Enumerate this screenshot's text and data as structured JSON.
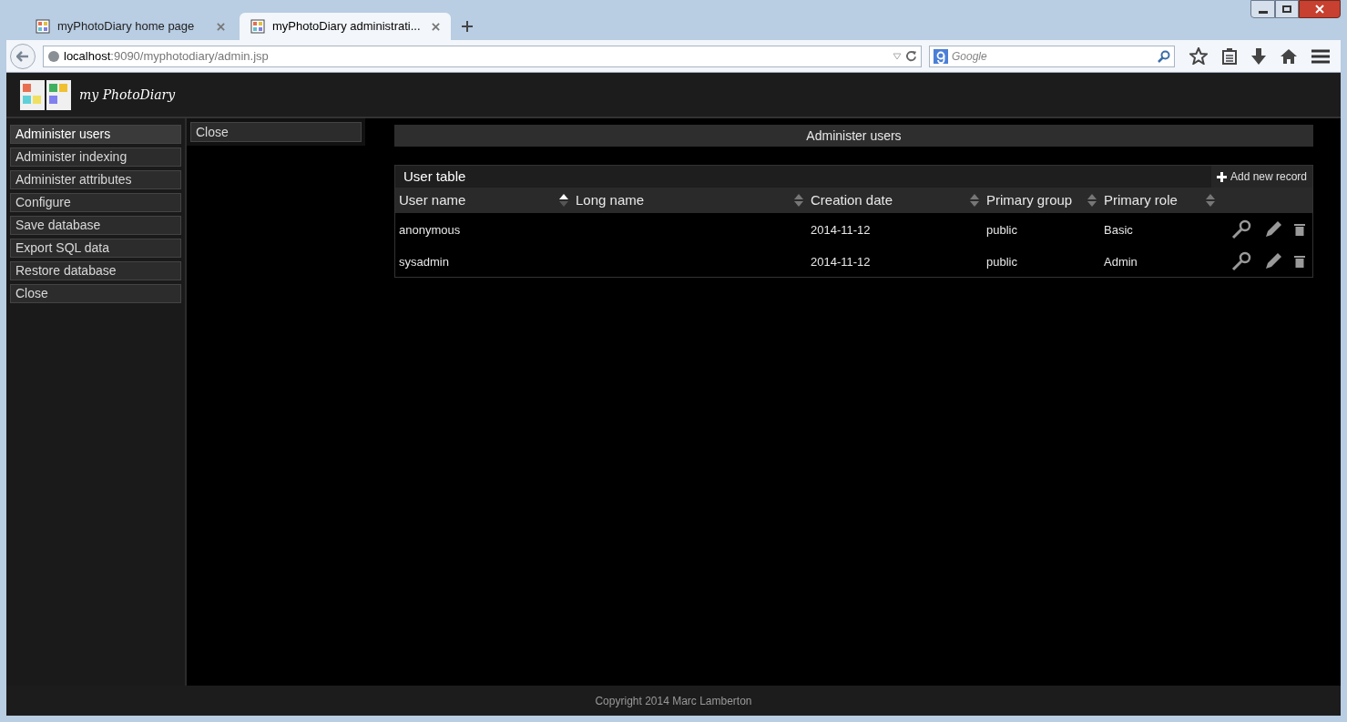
{
  "browser": {
    "tabs": [
      {
        "label": "myPhotoDiary home page",
        "selected": false
      },
      {
        "label": "myPhotoDiary administrati...",
        "selected": true
      }
    ],
    "url_host": "localhost",
    "url_path": ":9090/myphotodiary/admin.jsp",
    "search": {
      "placeholder": "Google"
    }
  },
  "header": {
    "logo_text": "my PhotoDiary"
  },
  "sidebar": {
    "items": [
      {
        "label": "Administer users",
        "selected": true
      },
      {
        "label": "Administer indexing",
        "selected": false
      },
      {
        "label": "Administer attributes",
        "selected": false
      },
      {
        "label": "Configure",
        "selected": false
      },
      {
        "label": "Save database",
        "selected": false
      },
      {
        "label": "Export SQL data",
        "selected": false
      },
      {
        "label": "Restore database",
        "selected": false
      },
      {
        "label": "Close",
        "selected": false
      }
    ]
  },
  "subpanel": {
    "items": [
      {
        "label": "Close"
      }
    ]
  },
  "main": {
    "title": "Administer users",
    "table": {
      "title": "User table",
      "add_button": "Add new record",
      "columns": [
        {
          "label": "User name",
          "sorted": true
        },
        {
          "label": "Long name",
          "sorted": false
        },
        {
          "label": "Creation date",
          "sorted": false
        },
        {
          "label": "Primary group",
          "sorted": false
        },
        {
          "label": "Primary role",
          "sorted": false
        }
      ],
      "rows": [
        [
          "anonymous",
          "",
          "2014-11-12",
          "public",
          "Basic"
        ],
        [
          "sysadmin",
          "",
          "2014-11-12",
          "public",
          "Admin"
        ]
      ]
    }
  },
  "footer": {
    "text": "Copyright 2014 Marc Lamberton"
  }
}
